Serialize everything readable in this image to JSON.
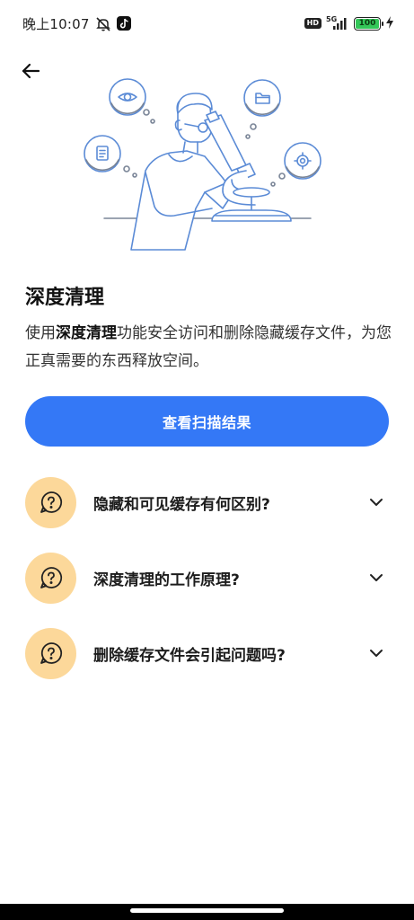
{
  "status_bar": {
    "time": "晚上10:07",
    "network": "5G",
    "hd": "HD",
    "battery": "100",
    "battery_level": 1.0,
    "icons": [
      "mute-icon",
      "tiktok-icon",
      "signal-icon",
      "battery-icon",
      "charging-icon"
    ]
  },
  "header": {
    "back_icon": "arrow-left-icon"
  },
  "illustration": {
    "subject": "scientist-with-microscope-illustration",
    "icons": [
      "eye-icon",
      "folder-icon",
      "document-icon",
      "gear-icon"
    ]
  },
  "main": {
    "title": "深度清理",
    "desc_part1": "使用",
    "desc_bold": "深度清理",
    "desc_part2": "功能安全访问和删除隐藏缓存文件，为您正真需要的东西释放空间。",
    "primary_button": "查看扫描结果"
  },
  "faq": [
    {
      "label": "隐藏和可见缓存有何区别?"
    },
    {
      "label": "深度清理的工作原理?"
    },
    {
      "label": "删除缓存文件会引起问题吗?"
    }
  ],
  "colors": {
    "accent": "#3478f6",
    "faq_icon_bg": "#fcd89a",
    "illustration_line": "#5b8bd6",
    "battery_green": "#34c759"
  }
}
